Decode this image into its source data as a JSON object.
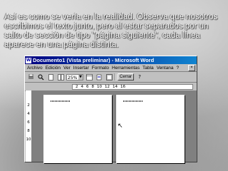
{
  "caption": "Así es como se vería en la realidad. Observa que nosotros escribimos el texto junto, pero al estar separados por un salto de sección de tipo \"página siguiente\", cada línea aparece en una página distinta.",
  "window": {
    "title": "Documento1 (Vista preliminar) - Microsoft Word",
    "app_icon": "W",
    "menu": [
      "Archivo",
      "Edición",
      "Ver",
      "Insertar",
      "Formato",
      "Herramientas",
      "Tabla",
      "Ventana",
      "?"
    ],
    "doc_close": "×",
    "toolbar": {
      "zoom": "25%",
      "close_label": "Cerrar",
      "help": "?"
    },
    "ruler_numbers": [
      "2",
      "4",
      "6",
      "8",
      "10",
      "12",
      "14",
      "16"
    ],
    "vruler_numbers": [
      "2",
      "4",
      "6",
      "8",
      "10"
    ]
  },
  "icons": [
    "print-icon",
    "magnifier-icon",
    "one-page-icon",
    "multiple-pages-icon",
    "view-ruler-icon",
    "shrink-to-fit-icon",
    "full-screen-icon",
    "help-icon",
    "mouse-cursor-icon"
  ]
}
